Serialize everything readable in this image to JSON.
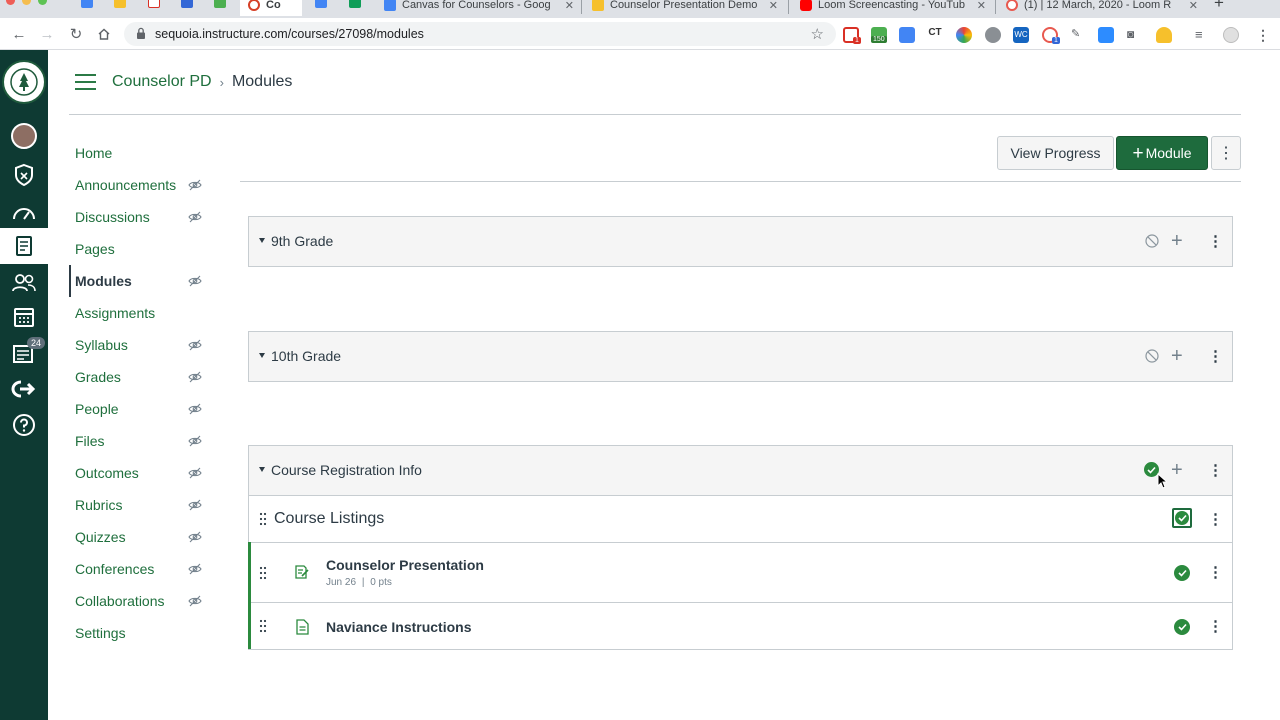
{
  "browser": {
    "tabs": [
      {
        "label": "Co"
      },
      {
        "label": "Canvas for Counselors - Goog"
      },
      {
        "label": "Counselor Presentation Demo"
      },
      {
        "label": "Loom Screencasting - YouTub"
      },
      {
        "label": "(1) | 12 March, 2020 - Loom R"
      }
    ],
    "new_tab": "+",
    "url": "sequoia.instructure.com/courses/27098/modules",
    "ext_badges": [
      "1",
      "150",
      "1"
    ]
  },
  "global_nav": {
    "inbox_badge": "24"
  },
  "breadcrumb": {
    "course": "Counselor PD",
    "separator": "›",
    "current": "Modules"
  },
  "course_nav": [
    {
      "label": "Home",
      "hidden": false
    },
    {
      "label": "Announcements",
      "hidden": true
    },
    {
      "label": "Discussions",
      "hidden": true
    },
    {
      "label": "Pages",
      "hidden": false
    },
    {
      "label": "Modules",
      "hidden": true,
      "active": true
    },
    {
      "label": "Assignments",
      "hidden": false
    },
    {
      "label": "Syllabus",
      "hidden": true
    },
    {
      "label": "Grades",
      "hidden": true
    },
    {
      "label": "People",
      "hidden": true
    },
    {
      "label": "Files",
      "hidden": true
    },
    {
      "label": "Outcomes",
      "hidden": true
    },
    {
      "label": "Rubrics",
      "hidden": true
    },
    {
      "label": "Quizzes",
      "hidden": true
    },
    {
      "label": "Conferences",
      "hidden": true
    },
    {
      "label": "Collaborations",
      "hidden": true
    },
    {
      "label": "Settings",
      "hidden": false
    }
  ],
  "actions": {
    "view_progress": "View Progress",
    "add_module_plus": "+",
    "add_module": "Module",
    "more": "⋮"
  },
  "modules": [
    {
      "title": "9th Grade",
      "published": false
    },
    {
      "title": "10th Grade",
      "published": false
    },
    {
      "title": "Course Registration Info",
      "published": true,
      "items": [
        {
          "title": "Course Listings",
          "type": "header"
        },
        {
          "title": "Counselor Presentation",
          "type": "assignment",
          "due": "Jun 26",
          "meta_sep": "|",
          "points": "0 pts"
        },
        {
          "title": "Naviance Instructions",
          "type": "page"
        }
      ]
    }
  ],
  "colors": {
    "brand_green": "#1e6b3d",
    "nav_bg": "#0e3a33",
    "link_green": "#1f6f3d",
    "published_green": "#2b8a3e"
  }
}
